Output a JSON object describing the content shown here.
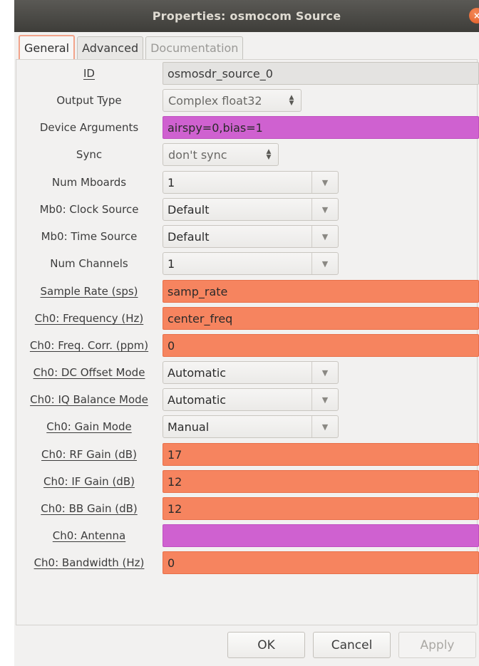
{
  "window": {
    "title": "Properties: osmocom Source",
    "close_icon": "close-icon"
  },
  "tabs": [
    {
      "label": "General",
      "active": true
    },
    {
      "label": "Advanced",
      "active": false
    },
    {
      "label": "Documentation",
      "active": false,
      "disabled": true
    }
  ],
  "fields": {
    "id": {
      "label": "ID",
      "value": "osmosdr_source_0"
    },
    "output_type": {
      "label": "Output Type",
      "value": "Complex float32"
    },
    "device_arguments": {
      "label": "Device Arguments",
      "value": "airspy=0,bias=1"
    },
    "sync": {
      "label": "Sync",
      "value": "don't sync"
    },
    "num_mboards": {
      "label": "Num Mboards",
      "value": "1"
    },
    "mb0_clock_source": {
      "label": "Mb0: Clock Source",
      "value": "Default"
    },
    "mb0_time_source": {
      "label": "Mb0: Time Source",
      "value": "Default"
    },
    "num_channels": {
      "label": "Num Channels",
      "value": "1"
    },
    "sample_rate": {
      "label": "Sample Rate (sps)",
      "value": "samp_rate"
    },
    "ch0_frequency": {
      "label": "Ch0: Frequency (Hz)",
      "value": "center_freq"
    },
    "ch0_freq_corr": {
      "label": "Ch0: Freq. Corr. (ppm)",
      "value": "0"
    },
    "ch0_dc_offset_mode": {
      "label": "Ch0: DC Offset Mode",
      "value": "Automatic"
    },
    "ch0_iq_balance_mode": {
      "label": "Ch0: IQ Balance Mode",
      "value": "Automatic"
    },
    "ch0_gain_mode": {
      "label": "Ch0: Gain Mode",
      "value": "Manual"
    },
    "ch0_rf_gain": {
      "label": "Ch0: RF Gain (dB)",
      "value": "17"
    },
    "ch0_if_gain": {
      "label": "Ch0: IF Gain (dB)",
      "value": "12"
    },
    "ch0_bb_gain": {
      "label": "Ch0: BB Gain (dB)",
      "value": "12"
    },
    "ch0_antenna": {
      "label": "Ch0: Antenna",
      "value": ""
    },
    "ch0_bandwidth": {
      "label": "Ch0: Bandwidth (Hz)",
      "value": "0"
    }
  },
  "buttons": {
    "ok": "OK",
    "cancel": "Cancel",
    "apply": "Apply"
  },
  "icons": {
    "spin_up": "▲",
    "spin_down": "▼",
    "dropdown": "▼",
    "close": "×"
  },
  "colors": {
    "title_bar": "#3e3d39",
    "entry_orange": "#f6845f",
    "entry_magenta": "#cf61d0",
    "active_tab_border": "#f2a38a"
  }
}
